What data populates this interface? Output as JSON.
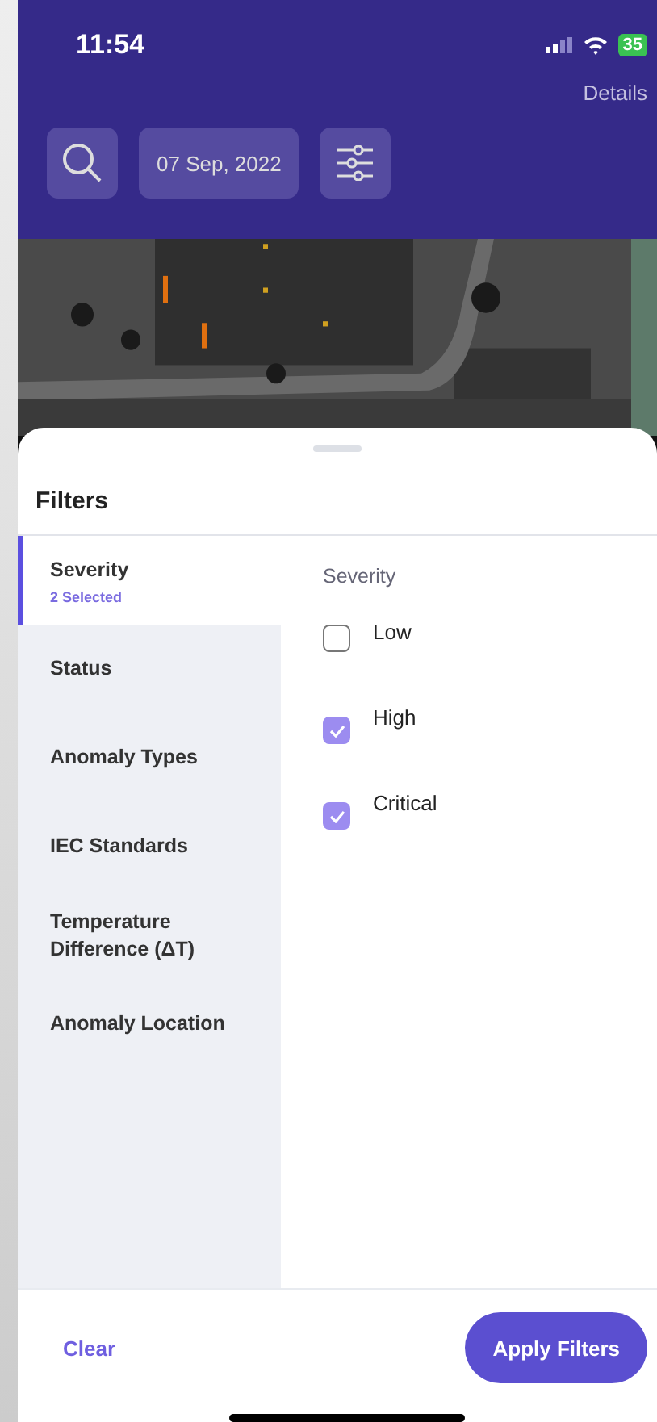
{
  "status_bar": {
    "time": "11:54",
    "battery": "35"
  },
  "header": {
    "details": "Details",
    "date": "07 Sep, 2022"
  },
  "map": {
    "kind": "map-picture"
  },
  "sheet": {
    "title": "Filters",
    "categories": [
      {
        "label": "Severity",
        "sublabel": "2 Selected",
        "selected": true
      },
      {
        "label": "Status",
        "selected": false
      },
      {
        "label": "Anomaly Types",
        "selected": false
      },
      {
        "label": "IEC Standards",
        "selected": false
      },
      {
        "label": "Temperature Difference (ΔT)",
        "selected": false
      },
      {
        "label": "Anomaly Location",
        "selected": false
      }
    ],
    "options_title": "Severity",
    "options": [
      {
        "label": "Low",
        "checked": false
      },
      {
        "label": "High",
        "checked": true
      },
      {
        "label": "Critical",
        "checked": true
      }
    ],
    "clear": "Clear",
    "apply": "Apply Filters"
  }
}
